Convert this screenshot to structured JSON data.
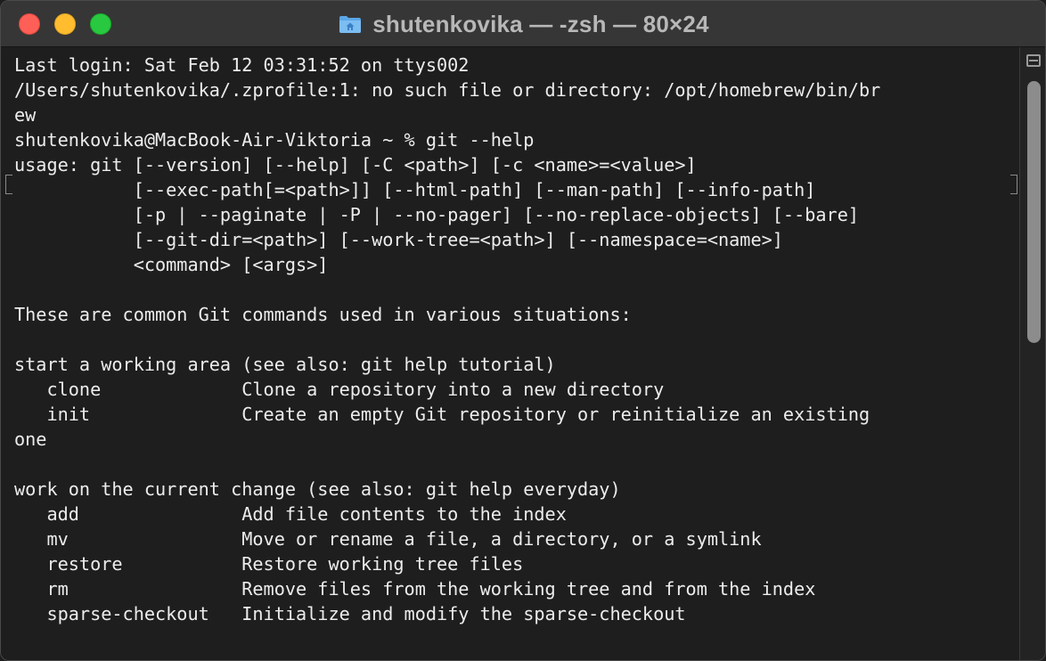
{
  "window": {
    "title": "shutenkovika — -zsh — 80×24",
    "title_icon": "folder-home-icon",
    "buttons": {
      "close_color": "#fe5f57",
      "minimize_color": "#febc2e",
      "zoom_color": "#28c840"
    }
  },
  "terminal": {
    "background": "#1e1e1e",
    "foreground": "#ececec",
    "lines": [
      "Last login: Sat Feb 12 03:31:52 on ttys002",
      "/Users/shutenkovika/.zprofile:1: no such file or directory: /opt/homebrew/bin/br",
      "ew",
      "shutenkovika@MacBook-Air-Viktoria ~ % git --help",
      "usage: git [--version] [--help] [-C <path>] [-c <name>=<value>]",
      "           [--exec-path[=<path>]] [--html-path] [--man-path] [--info-path]",
      "           [-p | --paginate | -P | --no-pager] [--no-replace-objects] [--bare]",
      "           [--git-dir=<path>] [--work-tree=<path>] [--namespace=<name>]",
      "           <command> [<args>]",
      "",
      "These are common Git commands used in various situations:",
      "",
      "start a working area (see also: git help tutorial)",
      "   clone             Clone a repository into a new directory",
      "   init              Create an empty Git repository or reinitialize an existing",
      "one",
      "",
      "work on the current change (see also: git help everyday)",
      "   add               Add file contents to the index",
      "   mv                Move or rename a file, a directory, or a symlink",
      "   restore           Restore working tree files",
      "   rm                Remove files from the working tree and from the index",
      "   sparse-checkout   Initialize and modify the sparse-checkout",
      ""
    ]
  }
}
